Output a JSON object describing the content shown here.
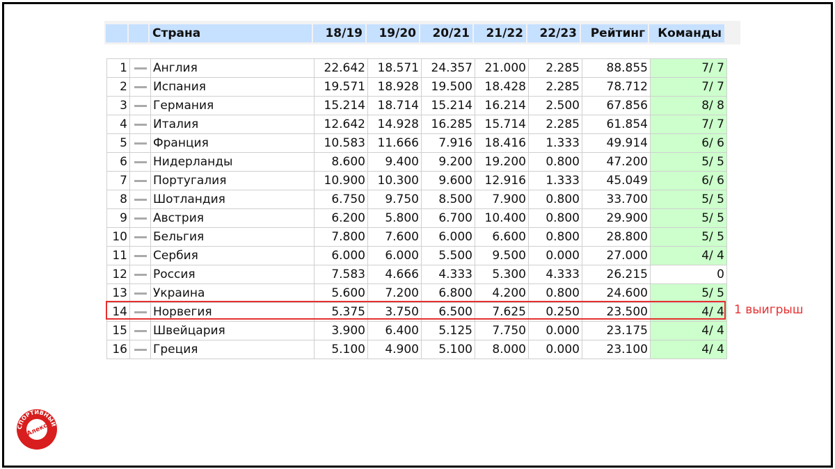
{
  "table": {
    "columns": [
      "",
      "",
      "Страна",
      "18/19",
      "19/20",
      "20/21",
      "21/22",
      "22/23",
      "Рейтинг",
      "Команды"
    ],
    "rows": [
      {
        "rank": "1",
        "country": "Англия",
        "v1819": "22.642",
        "v1920": "18.571",
        "v2021": "24.357",
        "v2122": "21.000",
        "v2223": "2.285",
        "rating": "88.855",
        "teams": "7/ 7"
      },
      {
        "rank": "2",
        "country": "Испания",
        "v1819": "19.571",
        "v1920": "18.928",
        "v2021": "19.500",
        "v2122": "18.428",
        "v2223": "2.285",
        "rating": "78.712",
        "teams": "7/ 7"
      },
      {
        "rank": "3",
        "country": "Германия",
        "v1819": "15.214",
        "v1920": "18.714",
        "v2021": "15.214",
        "v2122": "16.214",
        "v2223": "2.500",
        "rating": "67.856",
        "teams": "8/ 8"
      },
      {
        "rank": "4",
        "country": "Италия",
        "v1819": "12.642",
        "v1920": "14.928",
        "v2021": "16.285",
        "v2122": "15.714",
        "v2223": "2.285",
        "rating": "61.854",
        "teams": "7/ 7"
      },
      {
        "rank": "5",
        "country": "Франция",
        "v1819": "10.583",
        "v1920": "11.666",
        "v2021": "7.916",
        "v2122": "18.416",
        "v2223": "1.333",
        "rating": "49.914",
        "teams": "6/ 6"
      },
      {
        "rank": "6",
        "country": "Нидерланды",
        "v1819": "8.600",
        "v1920": "9.400",
        "v2021": "9.200",
        "v2122": "19.200",
        "v2223": "0.800",
        "rating": "47.200",
        "teams": "5/ 5"
      },
      {
        "rank": "7",
        "country": "Португалия",
        "v1819": "10.900",
        "v1920": "10.300",
        "v2021": "9.600",
        "v2122": "12.916",
        "v2223": "1.333",
        "rating": "45.049",
        "teams": "6/ 6"
      },
      {
        "rank": "8",
        "country": "Шотландия",
        "v1819": "6.750",
        "v1920": "9.750",
        "v2021": "8.500",
        "v2122": "7.900",
        "v2223": "0.800",
        "rating": "33.700",
        "teams": "5/ 5"
      },
      {
        "rank": "9",
        "country": "Австрия",
        "v1819": "6.200",
        "v1920": "5.800",
        "v2021": "6.700",
        "v2122": "10.400",
        "v2223": "0.800",
        "rating": "29.900",
        "teams": "5/ 5"
      },
      {
        "rank": "10",
        "country": "Бельгия",
        "v1819": "7.800",
        "v1920": "7.600",
        "v2021": "6.000",
        "v2122": "6.600",
        "v2223": "0.800",
        "rating": "28.800",
        "teams": "5/ 5"
      },
      {
        "rank": "11",
        "country": "Сербия",
        "v1819": "6.000",
        "v1920": "6.000",
        "v2021": "5.500",
        "v2122": "9.500",
        "v2223": "0.000",
        "rating": "27.000",
        "teams": "4/ 4"
      },
      {
        "rank": "12",
        "country": "Россия",
        "v1819": "7.583",
        "v1920": "4.666",
        "v2021": "4.333",
        "v2122": "5.300",
        "v2223": "4.333",
        "rating": "26.215",
        "teams": "0"
      },
      {
        "rank": "13",
        "country": "Украина",
        "v1819": "5.600",
        "v1920": "7.200",
        "v2021": "6.800",
        "v2122": "4.200",
        "v2223": "0.800",
        "rating": "24.600",
        "teams": "5/ 5"
      },
      {
        "rank": "14",
        "country": "Норвегия",
        "v1819": "5.375",
        "v1920": "3.750",
        "v2021": "6.500",
        "v2122": "7.625",
        "v2223": "0.250",
        "rating": "23.500",
        "teams": "4/ 4"
      },
      {
        "rank": "15",
        "country": "Швейцария",
        "v1819": "3.900",
        "v1920": "6.400",
        "v2021": "5.125",
        "v2122": "7.750",
        "v2223": "0.000",
        "rating": "23.175",
        "teams": "4/ 4"
      },
      {
        "rank": "16",
        "country": "Греция",
        "v1819": "5.100",
        "v1920": "4.900",
        "v2021": "5.100",
        "v2122": "8.000",
        "v2223": "0.000",
        "rating": "23.100",
        "teams": "4/ 4"
      }
    ]
  },
  "annotation": {
    "text": "1 выигрыш",
    "color": "#e53030"
  },
  "logo": {
    "text_center": "Алекс",
    "text_ring": "СПОРТИВНЫЙ",
    "color": "#d81e1e"
  },
  "colors": {
    "header_bg": "#c6e0ff",
    "teams_bg": "#ccffcc",
    "highlight": "#e53030"
  }
}
